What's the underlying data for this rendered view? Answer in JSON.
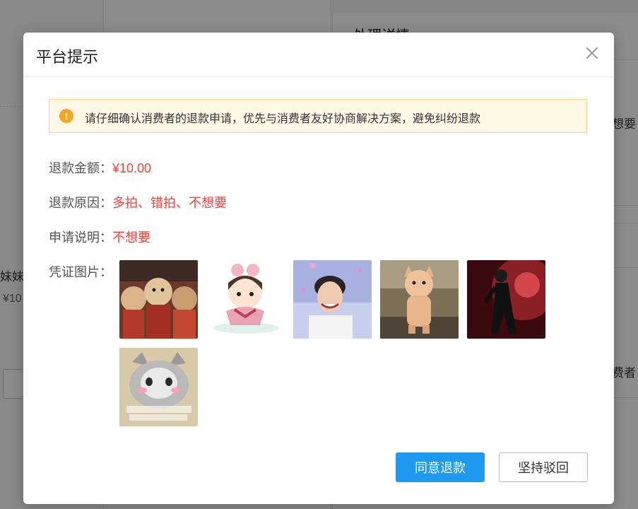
{
  "background": {
    "right_panel_title": "处理详情",
    "fragments": {
      "left_name": "妹妹",
      "left_price": "¥10",
      "right_reason": "想要",
      "right_consumer": "费者"
    }
  },
  "dialog": {
    "title": "平台提示",
    "alert": "请仔细确认消费者的退款申请，优先与消费者友好协商解决方案，避免纠纷退款",
    "fields": {
      "amount_label": "退款金额：",
      "amount_value": "¥10.00",
      "reason_label": "退款原因：",
      "reason_value": "多拍、错拍、不想要",
      "note_label": "申请说明：",
      "note_value": "不想要",
      "evidence_label": "凭证图片："
    },
    "evidence_images": [
      {
        "name": "teddy-bears-photo"
      },
      {
        "name": "cartoon-boy-sticker"
      },
      {
        "name": "smiling-man-photo"
      },
      {
        "name": "cat-costume-photo"
      },
      {
        "name": "dark-figure-photo"
      },
      {
        "name": "grey-cat-meme"
      }
    ],
    "buttons": {
      "agree": "同意退款",
      "reject": "坚持驳回"
    }
  },
  "colors": {
    "primary": "#1e9bf0",
    "value_red": "#f5423b",
    "alert_bg": "#fff8e6",
    "alert_border": "#f7d68a",
    "warning_icon": "#f5a623"
  },
  "icons": {
    "close": "close-icon",
    "warning": "warning-icon"
  }
}
